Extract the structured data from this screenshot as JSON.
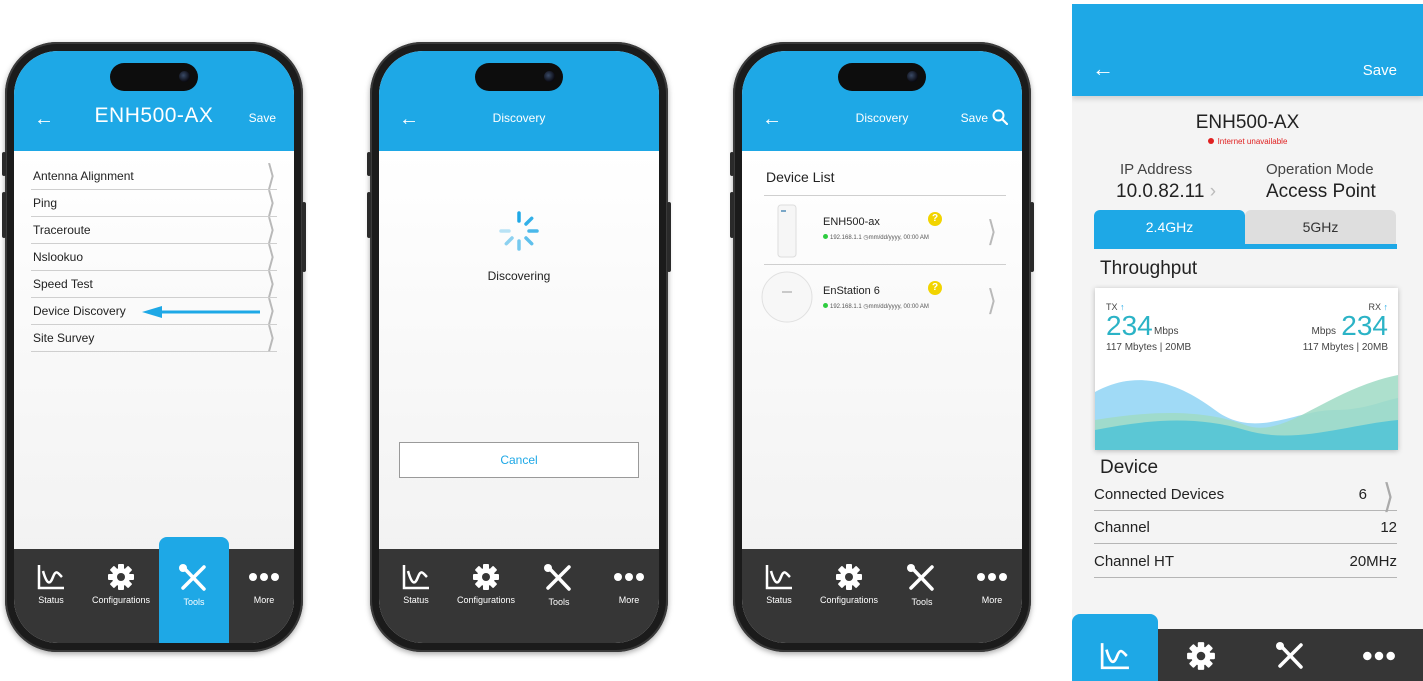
{
  "screen1": {
    "title": "ENH500-AX",
    "save_label": "Save",
    "tools": [
      "Antenna Alignment",
      "Ping",
      "Traceroute",
      "Nslookuo",
      "Speed Test",
      "Device Discovery",
      "Site Survey"
    ],
    "highlighted_tool": "Device Discovery",
    "active_tab": "Tools"
  },
  "screen2": {
    "title": "Discovery",
    "status_text": "Discovering",
    "cancel_label": "Cancel"
  },
  "screen3": {
    "title": "Discovery",
    "save_label": "Save",
    "list_title": "Device List",
    "devices": [
      {
        "name": "ENH500-ax",
        "ip": "192.168.1.1",
        "datetime": "mm/dd/yyyy, 00:00 AM",
        "status_color": "#2ecc40"
      },
      {
        "name": "EnStation 6",
        "ip": "192.168.1.1",
        "datetime": "mm/dd/yyyy, 00:00 AM",
        "status_color": "#2ecc40"
      }
    ]
  },
  "tabs": [
    "Status",
    "Configurations",
    "Tools",
    "More"
  ],
  "status_panel": {
    "save_label": "Save",
    "device_name": "ENH500-AX",
    "internet_status": "Internet unavailable",
    "ip_label": "IP Address",
    "ip_value": "10.0.82.11",
    "mode_label": "Operation Mode",
    "mode_value": "Access Point",
    "bands": [
      "2.4GHz",
      "5GHz"
    ],
    "active_band": "2.4GHz",
    "throughput_title": "Throughput",
    "tx": {
      "label": "TX",
      "value": "234",
      "unit": "Mbps",
      "detail": "117 Mbytes | 20MB"
    },
    "rx": {
      "label": "RX",
      "value": "234",
      "unit": "Mbps",
      "detail": "117 Mbytes | 20MB"
    },
    "device_section": "Device",
    "rows": [
      {
        "label": "Connected Devices",
        "value": "6"
      },
      {
        "label": "Channel",
        "value": "12"
      },
      {
        "label": "Channel HT",
        "value": "20MHz"
      }
    ],
    "active_tab": "Status"
  },
  "colors": {
    "accent": "#1ea8e6",
    "tabbar": "#363636",
    "online": "#2ecc40",
    "warning": "#f2d400",
    "error": "#e02020"
  }
}
